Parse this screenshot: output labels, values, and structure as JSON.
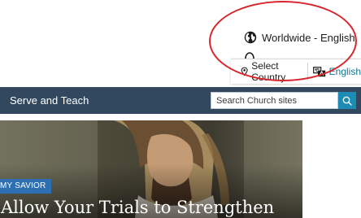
{
  "language_selector": {
    "current": "Worldwide - English",
    "current_icon": "globe-icon",
    "menu": {
      "select_country": "Select Country",
      "select_country_icon": "location-pin-icon",
      "language": "English",
      "language_icon": "language-icon"
    }
  },
  "nav": {
    "label": "Serve and Teach"
  },
  "search": {
    "placeholder": "Search Church sites",
    "icon": "search-icon"
  },
  "hero": {
    "badge": "MY SAVIOR",
    "headline": "Allow Your Trials to Strengthen"
  },
  "colors": {
    "nav_bg": "#31485f",
    "search_button": "#1c8bb5",
    "badge_bg": "#2d6fb2",
    "link": "#157493",
    "annotation": "#d8262c"
  }
}
